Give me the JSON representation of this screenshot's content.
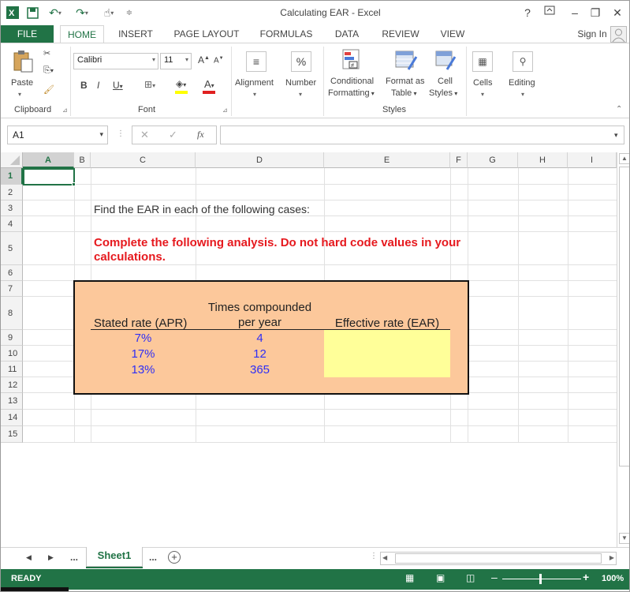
{
  "window": {
    "title": "Calculating EAR - Excel",
    "help": "?",
    "sign_in": "Sign In"
  },
  "tabs": [
    "FILE",
    "HOME",
    "INSERT",
    "PAGE LAYOUT",
    "FORMULAS",
    "DATA",
    "REVIEW",
    "VIEW"
  ],
  "ribbon": {
    "paste": "Paste",
    "font_name": "Calibri",
    "font_size": "11",
    "bold": "B",
    "italic": "I",
    "underline": "U",
    "grow_font": "A",
    "shrink_font": "A",
    "alignment": "Alignment",
    "number": "Number",
    "percent": "%",
    "conditional": "Conditional",
    "formatting": "Formatting",
    "format_as": "Format as",
    "table": "Table",
    "cell": "Cell",
    "styles": "Styles",
    "cells": "Cells",
    "editing": "Editing",
    "group_clipboard": "Clipboard",
    "group_font": "Font",
    "group_styles": "Styles"
  },
  "formula_bar": {
    "name_box": "A1",
    "fx": "fx",
    "formula": ""
  },
  "columns": [
    "A",
    "B",
    "C",
    "D",
    "E",
    "F",
    "G",
    "H",
    "I"
  ],
  "rows": [
    "1",
    "2",
    "3",
    "4",
    "5",
    "6",
    "7",
    "8",
    "9",
    "10",
    "11",
    "12",
    "13",
    "14",
    "15"
  ],
  "sheet": {
    "c3": "Find the EAR in each of the following cases:",
    "c5_line1": "Complete the following analysis. Do not hard code values in your",
    "c5_line2": "calculations.",
    "hdr_apr": "Stated rate (APR)",
    "hdr_times_1": "Times compounded",
    "hdr_times_2": "per year",
    "hdr_ear": "Effective rate (EAR)",
    "data": [
      {
        "apr": "7%",
        "times": "4"
      },
      {
        "apr": "17%",
        "times": "12"
      },
      {
        "apr": "13%",
        "times": "365"
      }
    ]
  },
  "sheet_tabs": {
    "ellipsis_left": "...",
    "active": "Sheet1",
    "ellipsis_right": "..."
  },
  "status": {
    "ready": "READY",
    "zoom": "100%"
  },
  "colors": {
    "excel_green": "#217346",
    "box_fill": "#fcc89b",
    "input_blue": "#2f2ff5",
    "answer_yellow": "#ffff99",
    "red_text": "#e6191e"
  }
}
